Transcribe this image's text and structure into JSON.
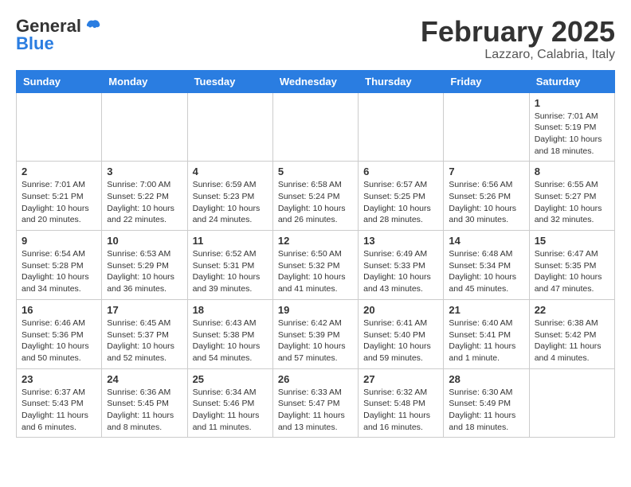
{
  "header": {
    "logo_general": "General",
    "logo_blue": "Blue",
    "month": "February 2025",
    "location": "Lazzaro, Calabria, Italy"
  },
  "weekdays": [
    "Sunday",
    "Monday",
    "Tuesday",
    "Wednesday",
    "Thursday",
    "Friday",
    "Saturday"
  ],
  "weeks": [
    [
      {
        "day": "",
        "info": ""
      },
      {
        "day": "",
        "info": ""
      },
      {
        "day": "",
        "info": ""
      },
      {
        "day": "",
        "info": ""
      },
      {
        "day": "",
        "info": ""
      },
      {
        "day": "",
        "info": ""
      },
      {
        "day": "1",
        "info": "Sunrise: 7:01 AM\nSunset: 5:19 PM\nDaylight: 10 hours\nand 18 minutes."
      }
    ],
    [
      {
        "day": "2",
        "info": "Sunrise: 7:01 AM\nSunset: 5:21 PM\nDaylight: 10 hours\nand 20 minutes."
      },
      {
        "day": "3",
        "info": "Sunrise: 7:00 AM\nSunset: 5:22 PM\nDaylight: 10 hours\nand 22 minutes."
      },
      {
        "day": "4",
        "info": "Sunrise: 6:59 AM\nSunset: 5:23 PM\nDaylight: 10 hours\nand 24 minutes."
      },
      {
        "day": "5",
        "info": "Sunrise: 6:58 AM\nSunset: 5:24 PM\nDaylight: 10 hours\nand 26 minutes."
      },
      {
        "day": "6",
        "info": "Sunrise: 6:57 AM\nSunset: 5:25 PM\nDaylight: 10 hours\nand 28 minutes."
      },
      {
        "day": "7",
        "info": "Sunrise: 6:56 AM\nSunset: 5:26 PM\nDaylight: 10 hours\nand 30 minutes."
      },
      {
        "day": "8",
        "info": "Sunrise: 6:55 AM\nSunset: 5:27 PM\nDaylight: 10 hours\nand 32 minutes."
      }
    ],
    [
      {
        "day": "9",
        "info": "Sunrise: 6:54 AM\nSunset: 5:28 PM\nDaylight: 10 hours\nand 34 minutes."
      },
      {
        "day": "10",
        "info": "Sunrise: 6:53 AM\nSunset: 5:29 PM\nDaylight: 10 hours\nand 36 minutes."
      },
      {
        "day": "11",
        "info": "Sunrise: 6:52 AM\nSunset: 5:31 PM\nDaylight: 10 hours\nand 39 minutes."
      },
      {
        "day": "12",
        "info": "Sunrise: 6:50 AM\nSunset: 5:32 PM\nDaylight: 10 hours\nand 41 minutes."
      },
      {
        "day": "13",
        "info": "Sunrise: 6:49 AM\nSunset: 5:33 PM\nDaylight: 10 hours\nand 43 minutes."
      },
      {
        "day": "14",
        "info": "Sunrise: 6:48 AM\nSunset: 5:34 PM\nDaylight: 10 hours\nand 45 minutes."
      },
      {
        "day": "15",
        "info": "Sunrise: 6:47 AM\nSunset: 5:35 PM\nDaylight: 10 hours\nand 47 minutes."
      }
    ],
    [
      {
        "day": "16",
        "info": "Sunrise: 6:46 AM\nSunset: 5:36 PM\nDaylight: 10 hours\nand 50 minutes."
      },
      {
        "day": "17",
        "info": "Sunrise: 6:45 AM\nSunset: 5:37 PM\nDaylight: 10 hours\nand 52 minutes."
      },
      {
        "day": "18",
        "info": "Sunrise: 6:43 AM\nSunset: 5:38 PM\nDaylight: 10 hours\nand 54 minutes."
      },
      {
        "day": "19",
        "info": "Sunrise: 6:42 AM\nSunset: 5:39 PM\nDaylight: 10 hours\nand 57 minutes."
      },
      {
        "day": "20",
        "info": "Sunrise: 6:41 AM\nSunset: 5:40 PM\nDaylight: 10 hours\nand 59 minutes."
      },
      {
        "day": "21",
        "info": "Sunrise: 6:40 AM\nSunset: 5:41 PM\nDaylight: 11 hours\nand 1 minute."
      },
      {
        "day": "22",
        "info": "Sunrise: 6:38 AM\nSunset: 5:42 PM\nDaylight: 11 hours\nand 4 minutes."
      }
    ],
    [
      {
        "day": "23",
        "info": "Sunrise: 6:37 AM\nSunset: 5:43 PM\nDaylight: 11 hours\nand 6 minutes."
      },
      {
        "day": "24",
        "info": "Sunrise: 6:36 AM\nSunset: 5:45 PM\nDaylight: 11 hours\nand 8 minutes."
      },
      {
        "day": "25",
        "info": "Sunrise: 6:34 AM\nSunset: 5:46 PM\nDaylight: 11 hours\nand 11 minutes."
      },
      {
        "day": "26",
        "info": "Sunrise: 6:33 AM\nSunset: 5:47 PM\nDaylight: 11 hours\nand 13 minutes."
      },
      {
        "day": "27",
        "info": "Sunrise: 6:32 AM\nSunset: 5:48 PM\nDaylight: 11 hours\nand 16 minutes."
      },
      {
        "day": "28",
        "info": "Sunrise: 6:30 AM\nSunset: 5:49 PM\nDaylight: 11 hours\nand 18 minutes."
      },
      {
        "day": "",
        "info": ""
      }
    ]
  ]
}
